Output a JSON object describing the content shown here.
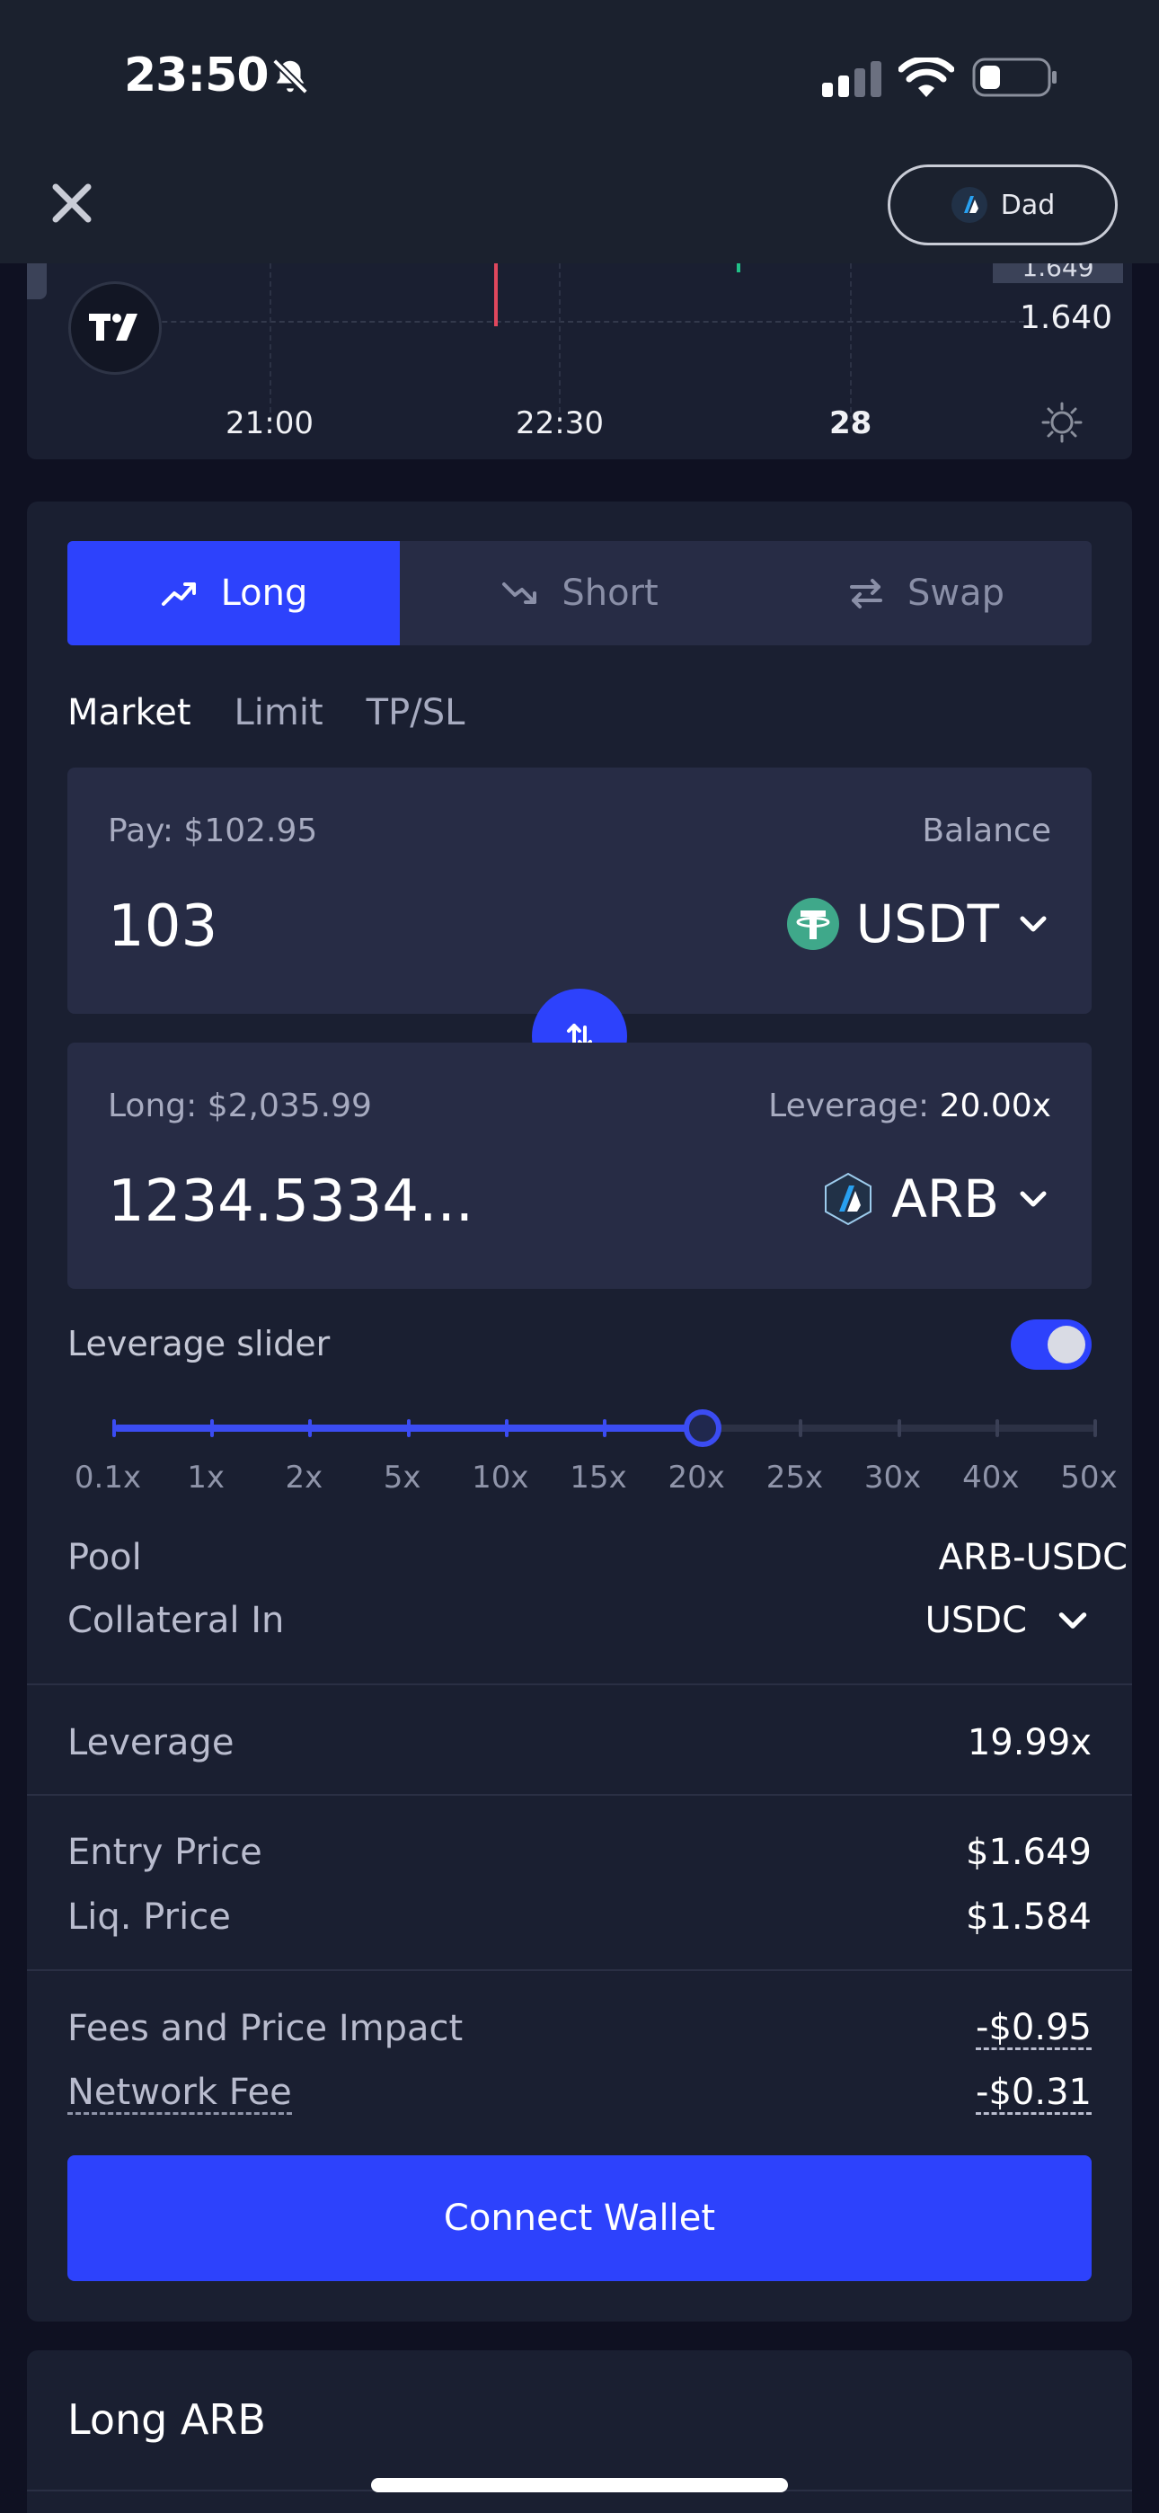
{
  "status_bar": {
    "time": "23:50",
    "icons": [
      "bell-slash-icon",
      "cellular-signal-icon",
      "wifi-icon",
      "battery-low-icon"
    ]
  },
  "nav": {
    "close_icon": "close-icon",
    "account_label": "Dad"
  },
  "chart": {
    "price_label": "1.640",
    "price_tag_partial": "1.649",
    "time_ticks": [
      "21:00",
      "22:30",
      "28"
    ]
  },
  "trade": {
    "tabs": [
      {
        "label": "Long",
        "icon": "trend-up-icon",
        "active": true
      },
      {
        "label": "Short",
        "icon": "trend-down-icon",
        "active": false
      },
      {
        "label": "Swap",
        "icon": "swap-arrows-icon",
        "active": false
      }
    ],
    "order_types": [
      "Market",
      "Limit",
      "TP/SL"
    ],
    "active_order_type": "Market",
    "pay": {
      "label": "Pay: $102.95",
      "balance_label": "Balance",
      "amount": "103",
      "token": "USDT"
    },
    "long": {
      "label": "Long: $2,035.99",
      "leverage_label": "Leverage:",
      "leverage_value": "20.00x",
      "amount": "1234.5334...",
      "token": "ARB"
    },
    "leverage_slider": {
      "label": "Leverage slider",
      "enabled": true,
      "marks": [
        "0.1x",
        "1x",
        "2x",
        "5x",
        "10x",
        "15x",
        "20x",
        "25x",
        "30x",
        "40x",
        "50x"
      ],
      "selected": "20x"
    },
    "details": {
      "pool_label": "Pool",
      "pool_value": "ARB-USDC",
      "collateral_label": "Collateral In",
      "collateral_value": "USDC",
      "leverage_label": "Leverage",
      "leverage_value": "19.99x",
      "entry_price_label": "Entry Price",
      "entry_price_value": "$1.649",
      "liq_price_label": "Liq. Price",
      "liq_price_value": "$1.584",
      "fees_label": "Fees and Price Impact",
      "fees_value": "-$0.95",
      "network_fee_label": "Network Fee",
      "network_fee_value": "-$0.31"
    },
    "connect_button": "Connect Wallet"
  },
  "bottom_card": {
    "title": "Long ARB"
  },
  "colors": {
    "accent": "#2d42fc",
    "background": "#0f1122",
    "card": "#1a1f31",
    "input": "#272c45"
  }
}
